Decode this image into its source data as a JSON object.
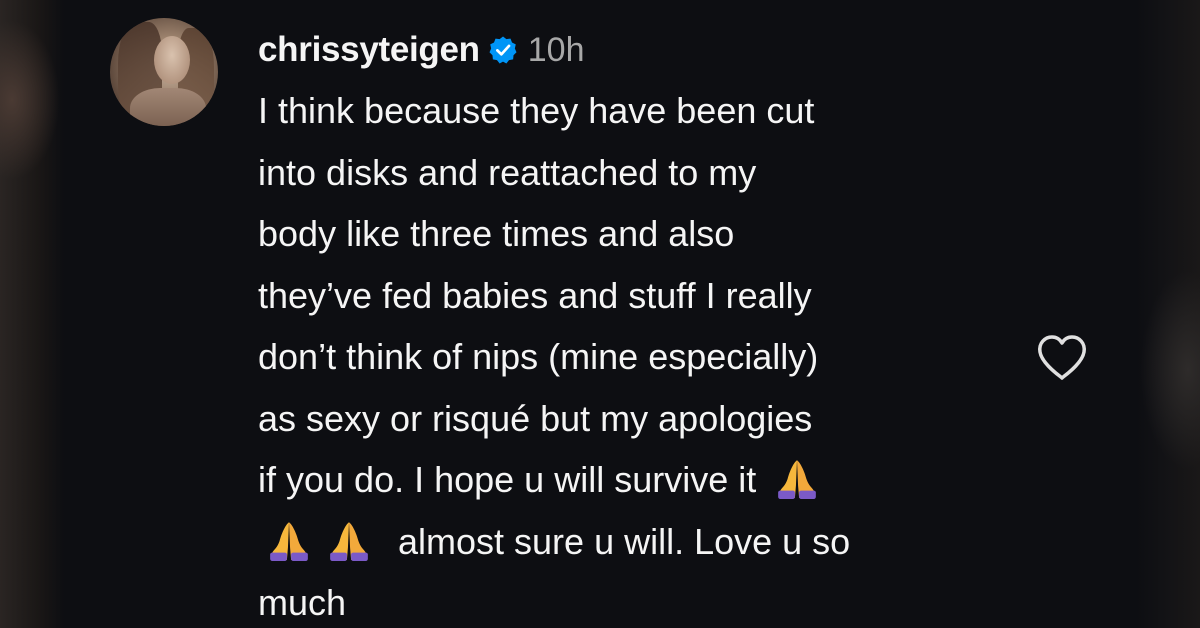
{
  "comment": {
    "username": "chrissyteigen",
    "verified": true,
    "timestamp": "10h",
    "lines": [
      "I think because they have been cut",
      "into disks and reattached to my",
      "body like three times and also",
      "they’ve fed babies and stuff I really",
      "don’t think of nips (mine especially)",
      "as sexy or risqué but my apologies",
      "if you do. I hope u will survive it"
    ],
    "line8_text": "almost sure u will. Love u so",
    "line9_text": "much",
    "emoji": "🙏"
  },
  "icons": {
    "avatar": "profile-photo",
    "verified_badge": "verified-badge-icon",
    "like": "heart-outline-icon"
  },
  "colors": {
    "background": "#0d0e12",
    "text": "#f5f5f5",
    "timestamp": "#a8a8a8",
    "verified": "#0095f6",
    "emoji": "#f6b73c"
  }
}
